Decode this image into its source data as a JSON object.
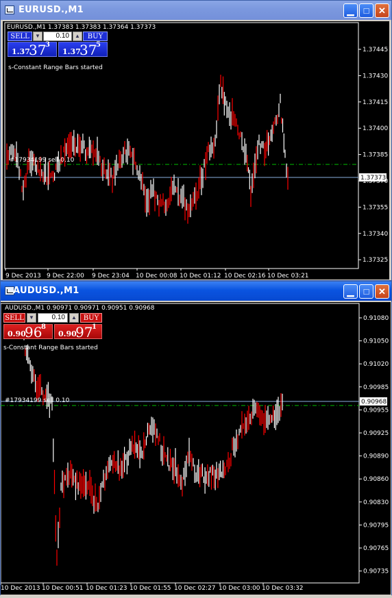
{
  "windows": [
    {
      "title": "EURUSD.,M1",
      "active": false,
      "header": "EURUSD.,M1  1.37383 1.37383 1.37364 1.37373",
      "status": "s-Constant Range Bars started",
      "order_label": "#17934199 sell 0.10",
      "trade": {
        "sell_label": "SELL",
        "buy_label": "BUY",
        "lot": "0.10",
        "bid_prefix": "1.37",
        "bid_big": "37",
        "bid_sup": "3",
        "ask_prefix": "1.37",
        "ask_big": "37",
        "ask_sup": "5",
        "theme": "blue"
      },
      "price_ticks": [
        "1.37445",
        "1.37430",
        "1.37415",
        "1.37400",
        "1.37385",
        "1.37370",
        "1.37355",
        "1.37340",
        "1.37325"
      ],
      "current_price": "1.37373",
      "time_ticks": [
        "9 Dec 2013",
        "9 Dec 22:00",
        "9 Dec 23:04",
        "10 Dec 00:08",
        "10 Dec 01:12",
        "10 Dec 02:16",
        "10 Dec 03:21"
      ],
      "colors": {
        "up": "#ffffff",
        "down": "#ff0000",
        "grid": "#00c000",
        "line": "#8ab0e0"
      }
    },
    {
      "title": "AUDUSD.,M1",
      "active": true,
      "header": "AUDUSD.,M1  0.90971 0.90971 0.90951 0.90968",
      "status": "s-Constant Range Bars started",
      "order_label": "#17934199 sell 0.10",
      "trade": {
        "sell_label": "SELL",
        "buy_label": "BUY",
        "lot": "0.10",
        "bid_prefix": "0.90",
        "bid_big": "96",
        "bid_sup": "8",
        "ask_prefix": "0.90",
        "ask_big": "97",
        "ask_sup": "1",
        "theme": "red"
      },
      "price_ticks": [
        "0.91080",
        "0.91050",
        "0.91020",
        "0.90985",
        "0.90955",
        "0.90925",
        "0.90890",
        "0.90860",
        "0.90830",
        "0.90795",
        "0.90765",
        "0.90735"
      ],
      "current_price": "0.90968",
      "time_ticks": [
        "10 Dec 2013",
        "10 Dec 00:51",
        "10 Dec 01:23",
        "10 Dec 01:55",
        "10 Dec 02:27",
        "10 Dec 03:00",
        "10 Dec 03:32"
      ],
      "colors": {
        "up": "#ffffff",
        "down": "#ff0000",
        "grid": "#00c000",
        "line": "#8ab0e0"
      }
    }
  ]
}
